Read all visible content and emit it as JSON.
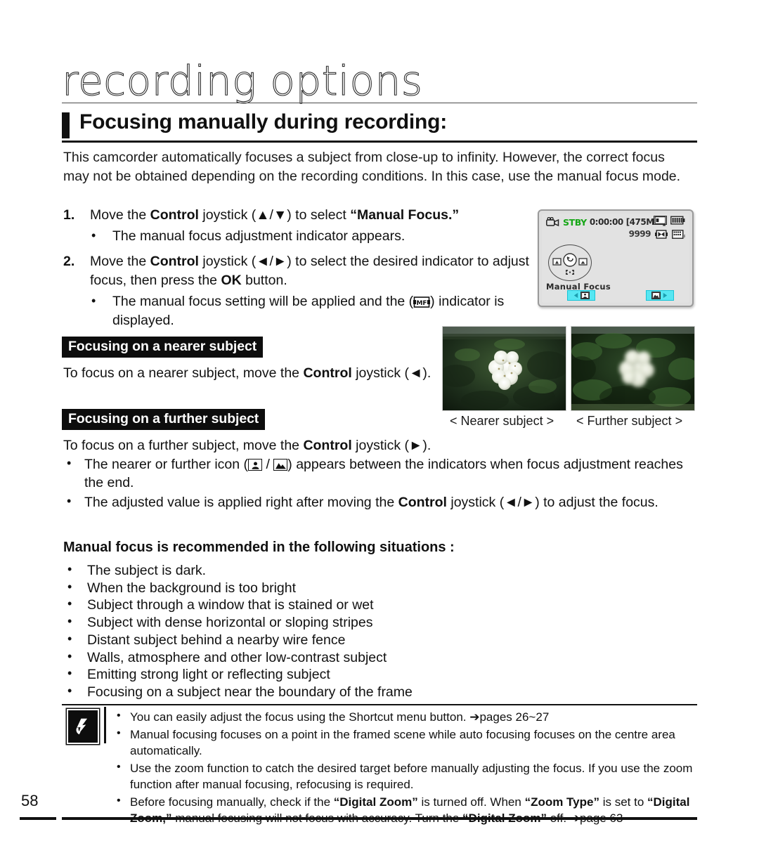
{
  "document": {
    "chapter_title": "recording options",
    "section_title": "Focusing manually during recording:",
    "page_number": "58"
  },
  "intro": {
    "text": "This camcorder automatically focuses a subject from close-up to infinity. However, the correct focus may not be obtained depending on the recording conditions. In this case, use the manual focus mode."
  },
  "steps": [
    {
      "number": "1.",
      "text_parts": [
        "Move the ",
        "Control",
        " joystick (▲/▼) to select ",
        "“Manual Focus.”"
      ],
      "sub": "The manual focus adjustment indicator appears."
    },
    {
      "number": "2.",
      "text_parts": [
        "Move the ",
        "Control",
        " joystick (◄/►) to select the desired indicator to adjust focus, then press the ",
        "OK",
        " button."
      ],
      "sub_prefix": "The manual focus setting will be applied and the (",
      "sub_suffix": ") indicator is displayed."
    }
  ],
  "nearer_section": {
    "tag": "Focusing on a nearer subject",
    "line_prefix": "To focus on a nearer subject, move the ",
    "line_bold": "Control",
    "line_suffix": " joystick (◄)."
  },
  "further_section": {
    "tag": "Focusing on a further subject",
    "line_prefix": "To focus on a further subject, move the ",
    "line_bold": "Control",
    "line_suffix": " joystick (►)."
  },
  "mid_bullets": [
    {
      "prefix": "The nearer or further icon (",
      "mid": " / ",
      "suffix": ") appears between the indicators when focus adjustment reaches the end."
    },
    {
      "prefix": "The adjusted value is applied right after moving the ",
      "bold": "Control",
      "suffix": " joystick (◄/►) to adjust the focus."
    }
  ],
  "recommended": {
    "title": "Manual focus is recommended in the following situations :",
    "items": [
      "The subject is dark.",
      "When the background is too bright",
      "Subject through a window that is stained or wet",
      "Subject with dense horizontal or sloping stripes",
      "Distant subject behind a nearby wire fence",
      "Walls, atmosphere and other low-contrast subject",
      "Emitting strong light or reflecting subject",
      "Focusing on a subject near the boundary of the frame"
    ]
  },
  "notes": {
    "icon": "note-hand-icon",
    "items": [
      {
        "text": "You can easily adjust the focus using the Shortcut menu button. ➔pages 26~27",
        "plain": true
      },
      {
        "text": "Manual focusing focuses on a point in the framed scene while auto focusing focuses on the centre area automatically.",
        "plain": true
      },
      {
        "text": "Use the zoom function to catch the desired target before manually adjusting the focus. If you use the zoom function after manual focusing, refocusing is required.",
        "plain": true
      },
      {
        "prefix": "Before focusing manually, check if the ",
        "b1": "“Digital Zoom”",
        "mid1": " is turned off. When ",
        "b2": "“Zoom Type”",
        "mid2": " is set to ",
        "b3": "“Digital Zoom,”",
        "mid3": " manual focusing will not focus with accuracy. Turn the ",
        "b4": "“Digital Zoom”",
        "suffix": " off. ➔page 63"
      }
    ]
  },
  "lcd": {
    "status": "STBY",
    "timecode": "0:00:00",
    "remaining": "[475Min]",
    "photo_count": "9999",
    "mode_label": "Manual Focus",
    "icons": {
      "camera": "camcorder-icon",
      "card": "memory-card-icon",
      "battery": "battery-icon",
      "quality": "quality-icon",
      "resolution": "resolution-icon"
    },
    "left_button": "nearer-focus-button",
    "right_button": "further-focus-button",
    "colors": {
      "stby": "#16a616",
      "button": "#57e6f2",
      "screen": "#e2e2e2"
    }
  },
  "photos": [
    {
      "name": "nearer-subject-photo",
      "caption": "< Nearer subject >"
    },
    {
      "name": "further-subject-photo",
      "caption": "< Further subject >"
    }
  ]
}
